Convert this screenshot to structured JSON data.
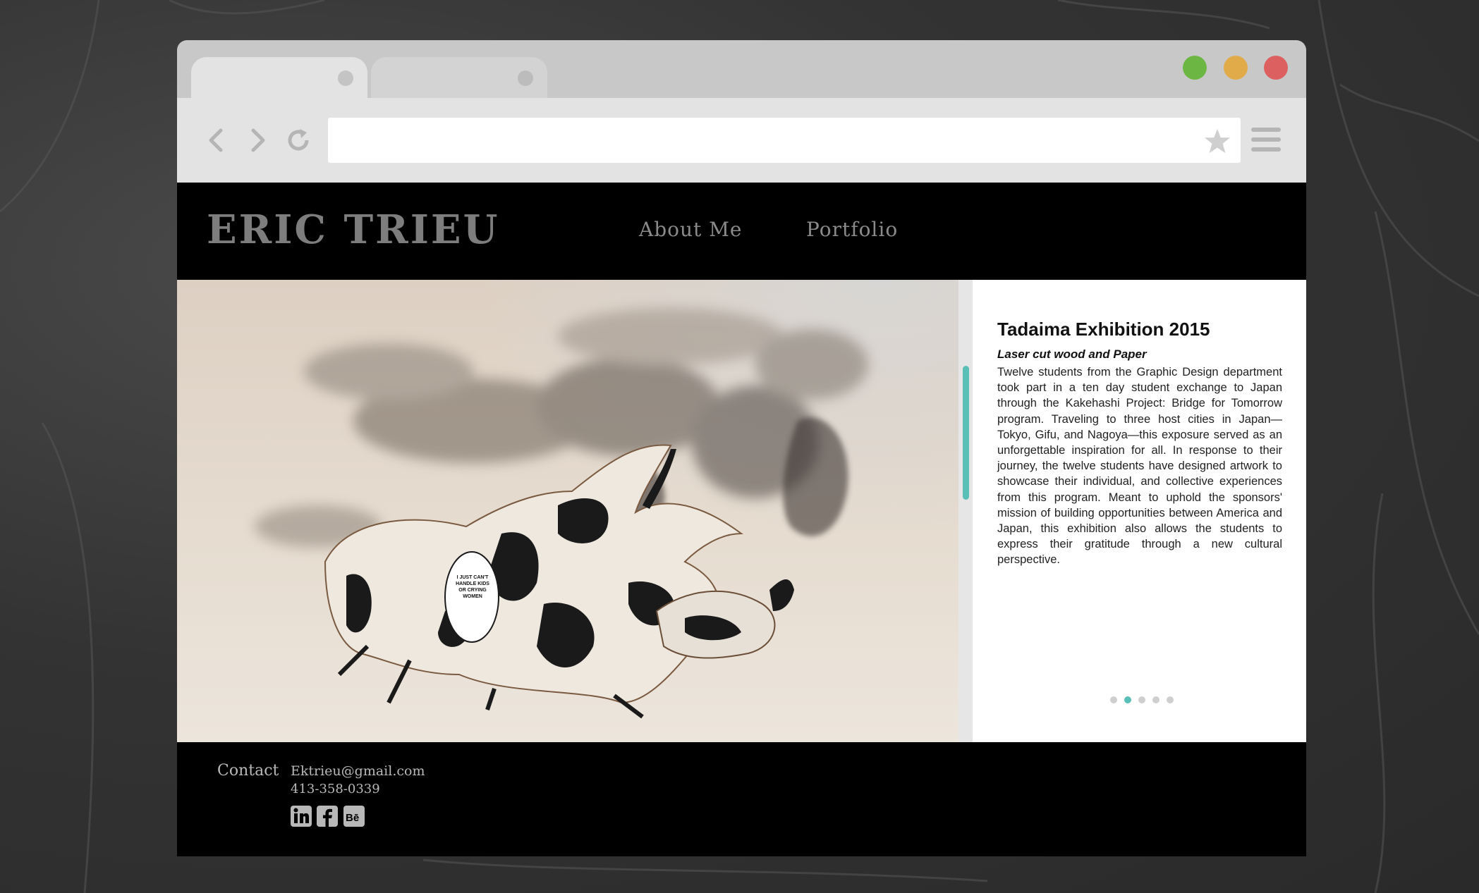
{
  "browser": {
    "tabs": [
      {
        "state": "active"
      },
      {
        "state": "inactive"
      }
    ],
    "window_buttons": [
      {
        "name": "maximize",
        "color": "#6cb643"
      },
      {
        "name": "minimize",
        "color": "#e2ab4a"
      },
      {
        "name": "close",
        "color": "#dc6060"
      }
    ],
    "address_value": "",
    "icons": [
      "back-arrow-icon",
      "forward-arrow-icon",
      "reload-icon",
      "bookmark-star-icon",
      "hamburger-menu-icon"
    ]
  },
  "site": {
    "logo": "ERIC TRIEU",
    "nav": [
      {
        "label": "About Me"
      },
      {
        "label": "Portfolio"
      }
    ]
  },
  "hero": {
    "image": "laser-cut-beetle-photo",
    "speech_bubble": "I JUST CAN'T HANDLE KIDS OR CRYING WOMEN"
  },
  "project": {
    "title": "Tadaima Exhibition 2015",
    "subtitle": "Laser cut wood and Paper",
    "description": "Twelve students from the Graphic Design department took part in a ten day student exchange to Japan through the Kakehashi Project: Bridge for Tomorrow program. Traveling to three host cities in Japan—Tokyo, Gifu, and Nagoya—this exposure served as an unforgettable inspiration for all. In response to their journey, the twelve students have designed artwork to showcase their individual, and collective experiences from this program. Meant to uphold the sponsors' mission of building opportunities between America and Japan, this exhibition also allows the students to express their gratitude through a new cultural perspective.",
    "slides_total": 5,
    "slide_active": 2,
    "accent_color": "#5abfb7"
  },
  "footer": {
    "contact_label": "Contact",
    "email": "Ektrieu@gmail.com",
    "phone": "413-358-0339",
    "social": [
      {
        "name": "linkedin-icon",
        "glyph": "in"
      },
      {
        "name": "facebook-icon",
        "glyph": "f"
      },
      {
        "name": "behance-icon",
        "glyph": "Bē"
      }
    ]
  }
}
